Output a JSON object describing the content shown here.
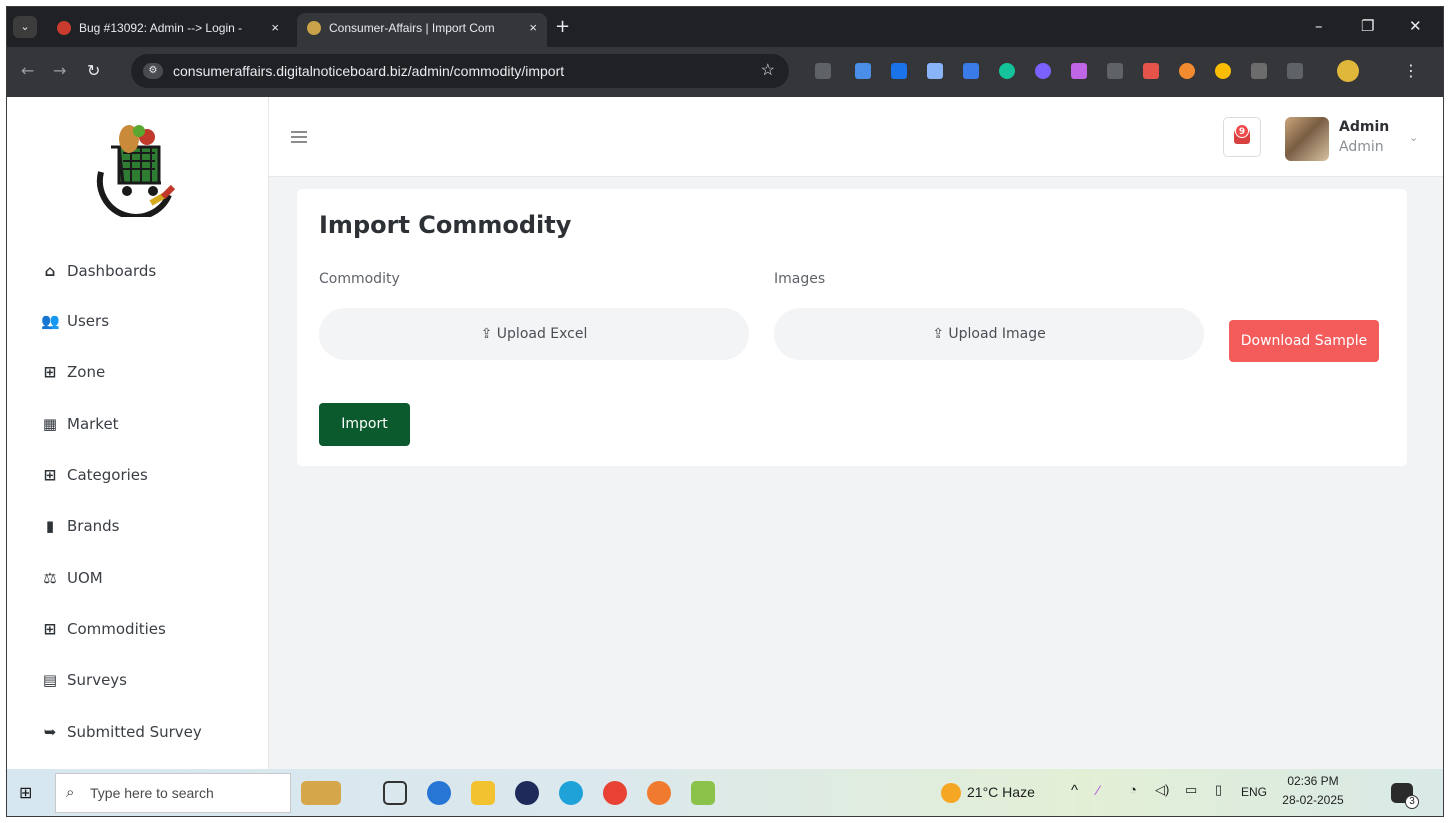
{
  "browser": {
    "tabs": [
      {
        "title": "Bug #13092: Admin --> Login -",
        "close": "×"
      },
      {
        "title": "Consumer-Affairs | Import Com",
        "close": "×"
      }
    ],
    "new_tab": "+",
    "url": "consumeraffairs.digitalnoticeboard.biz/admin/commodity/import",
    "window_controls": {
      "minimize": "–",
      "restore": "❐",
      "close": "✕"
    }
  },
  "sidebar": {
    "items": [
      {
        "label": "Dashboards",
        "icon": "home-icon"
      },
      {
        "label": "Users",
        "icon": "users-icon"
      },
      {
        "label": "Zone",
        "icon": "grid-icon"
      },
      {
        "label": "Market",
        "icon": "store-icon"
      },
      {
        "label": "Categories",
        "icon": "grid-icon"
      },
      {
        "label": "Brands",
        "icon": "bag-icon"
      },
      {
        "label": "UOM",
        "icon": "scale-icon"
      },
      {
        "label": "Commodities",
        "icon": "grid-icon"
      },
      {
        "label": "Surveys",
        "icon": "form-icon"
      },
      {
        "label": "Submitted Survey",
        "icon": "file-export-icon"
      }
    ]
  },
  "header": {
    "notification_count": "9",
    "user_name": "Admin",
    "user_role": "Admin"
  },
  "main": {
    "title": "Import Commodity",
    "commodity_label": "Commodity",
    "images_label": "Images",
    "upload_excel": "Upload Excel",
    "upload_image": "Upload Image",
    "download_sample": "Download Sample",
    "import_button": "Import"
  },
  "taskbar": {
    "search_placeholder": "Type here to search",
    "weather": "21°C  Haze",
    "language": "ENG",
    "time": "02:36 PM",
    "date": "28-02-2025",
    "notification_count": "3"
  },
  "colors": {
    "accent_green": "#0a5a2e",
    "accent_red": "#f45c5c",
    "browser_dark": "#202124"
  }
}
